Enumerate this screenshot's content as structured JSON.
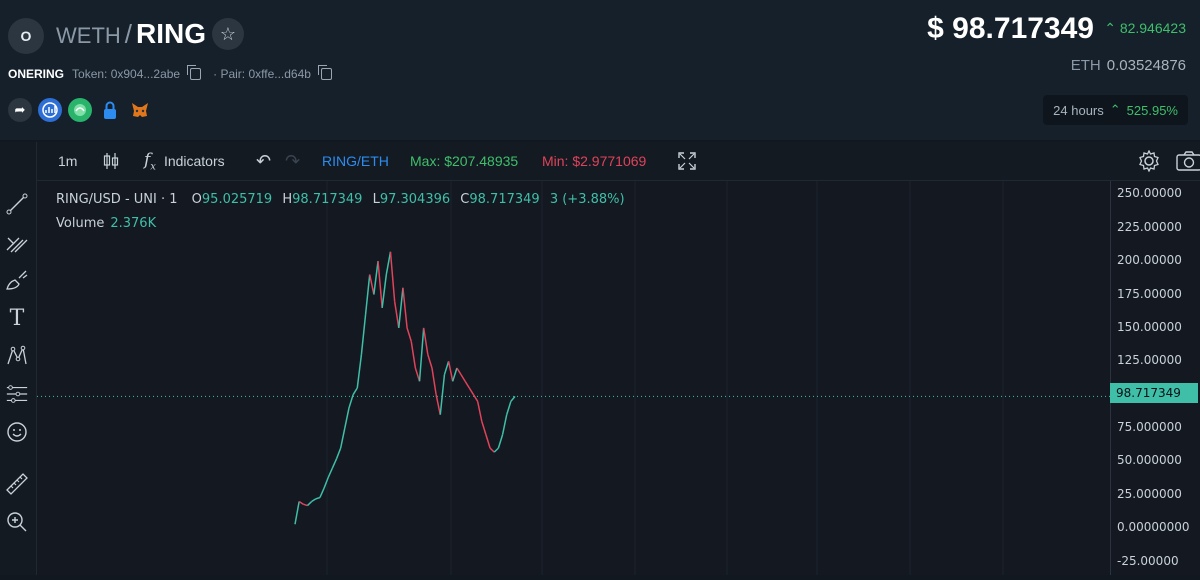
{
  "header": {
    "logo_letter": "O",
    "base": "WETH",
    "slash": "/",
    "quote": "RING",
    "favorite_icon": "star-icon",
    "token_name": "ONERING",
    "token_label": "Token: 0x904...2abe",
    "pair_label": "· Pair: 0xffe...d64b",
    "price": "$ 98.717349",
    "price_change": "82.946423",
    "eth_label": "ETH",
    "eth_value": "0.03524876",
    "period_label": "24 hours",
    "period_change": "525.95%",
    "links": [
      "share-icon",
      "chart-site-icon",
      "swap-icon",
      "lock-icon",
      "metamask-icon"
    ]
  },
  "toolbar": {
    "interval": "1m",
    "indicators": "Indicators",
    "symbol": "RING/ETH",
    "max": "Max: $207.48935",
    "min": "Min: $2.9771069"
  },
  "legend": {
    "symbol": "RING/USD - UNI · 1",
    "o_label": "O",
    "o_value": "95.025719",
    "h_label": "H",
    "h_value": "98.717349",
    "l_label": "L",
    "l_value": "97.304396",
    "c_label": "C",
    "c_value": "98.717349",
    "change": "3 (+3.88%)",
    "volume_label": "Volume",
    "volume_value": "2.376K"
  },
  "chart_data": {
    "type": "line",
    "title": "RING/USD - UNI · 1",
    "xlabel": "",
    "ylabel": "",
    "ylim": [
      -35,
      260
    ],
    "y_ticks": [
      "250.00000",
      "225.00000",
      "200.00000",
      "175.00000",
      "150.00000",
      "125.00000",
      "100.00000",
      "75.000000",
      "50.000000",
      "25.000000",
      "0.00000000",
      "-25.00000"
    ],
    "current_price": 98.717349,
    "current_price_label": "98.717349",
    "series": [
      {
        "values": [
          3,
          20,
          18,
          17,
          20,
          22,
          23,
          30,
          38,
          45,
          52,
          60,
          75,
          90,
          100,
          105,
          130,
          160,
          190,
          175,
          200,
          165,
          190,
          207,
          170,
          150,
          180,
          150,
          140,
          120,
          110,
          150,
          130,
          120,
          100,
          85,
          115,
          125,
          110,
          120,
          115,
          110,
          105,
          100,
          95,
          80,
          70,
          60,
          57,
          60,
          70,
          85,
          95,
          98.7
        ]
      }
    ]
  }
}
